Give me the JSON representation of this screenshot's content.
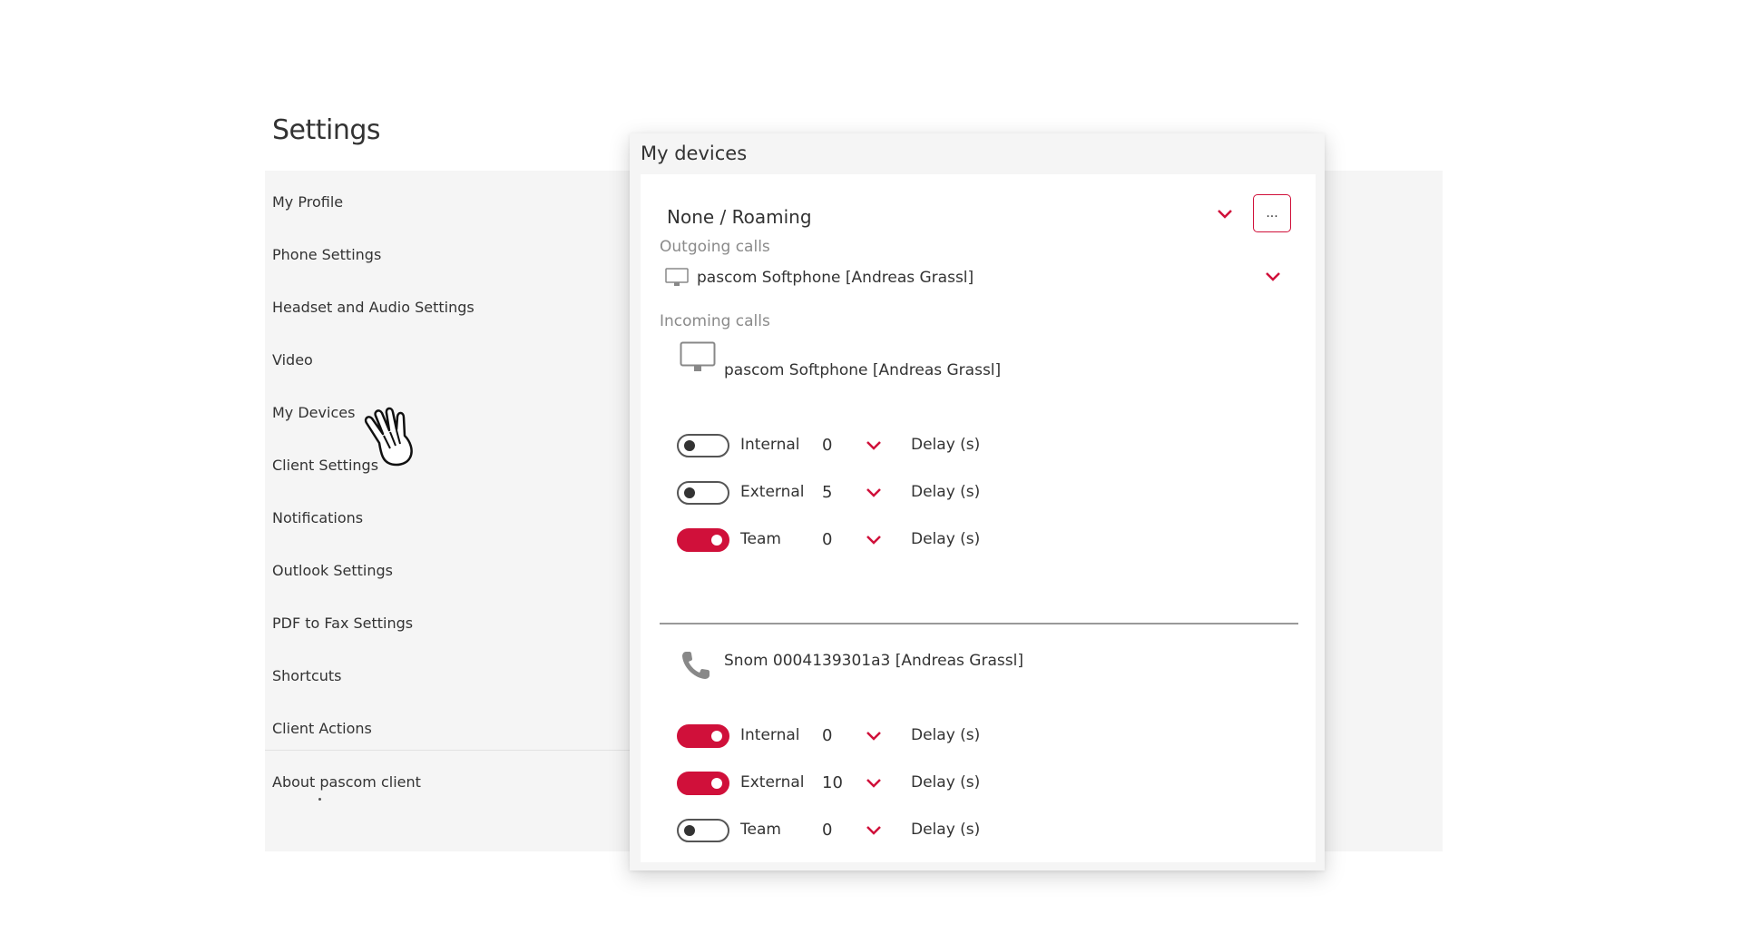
{
  "settings": {
    "title": "Settings",
    "nav": [
      {
        "label": "My Profile"
      },
      {
        "label": "Phone Settings"
      },
      {
        "label": "Headset and Audio Settings"
      },
      {
        "label": "Video"
      },
      {
        "label": "My Devices"
      },
      {
        "label": "Client Settings"
      },
      {
        "label": "Notifications"
      },
      {
        "label": "Outlook Settings"
      },
      {
        "label": "PDF to Fax Settings"
      },
      {
        "label": "Shortcuts"
      },
      {
        "label": "Client Actions"
      },
      {
        "label": "About pascom client"
      }
    ]
  },
  "modal": {
    "title": "My devices",
    "roaming": "None / Roaming",
    "more_label": "...",
    "outgoing_label": "Outgoing calls",
    "outgoing_device": "pascom Softphone [Andreas Grassl]",
    "incoming_label": "Incoming calls",
    "devices": [
      {
        "name": "pascom Softphone [Andreas Grassl]",
        "icon": "monitor-icon",
        "rows": [
          {
            "label": "Internal",
            "enabled": false,
            "value": "0",
            "delay_label": "Delay (s)"
          },
          {
            "label": "External",
            "enabled": false,
            "value": "5",
            "delay_label": "Delay (s)"
          },
          {
            "label": "Team",
            "enabled": true,
            "value": "0",
            "delay_label": "Delay (s)"
          }
        ]
      },
      {
        "name": "Snom 0004139301a3 [Andreas Grassl]",
        "icon": "phone-icon",
        "rows": [
          {
            "label": "Internal",
            "enabled": true,
            "value": "0",
            "delay_label": "Delay (s)"
          },
          {
            "label": "External",
            "enabled": true,
            "value": "10",
            "delay_label": "Delay (s)"
          },
          {
            "label": "Team",
            "enabled": false,
            "value": "0",
            "delay_label": "Delay (s)"
          }
        ]
      }
    ]
  },
  "colors": {
    "accent": "#d0103a",
    "panel_bg": "#f5f5f5",
    "muted_text": "#8a8a8a"
  }
}
